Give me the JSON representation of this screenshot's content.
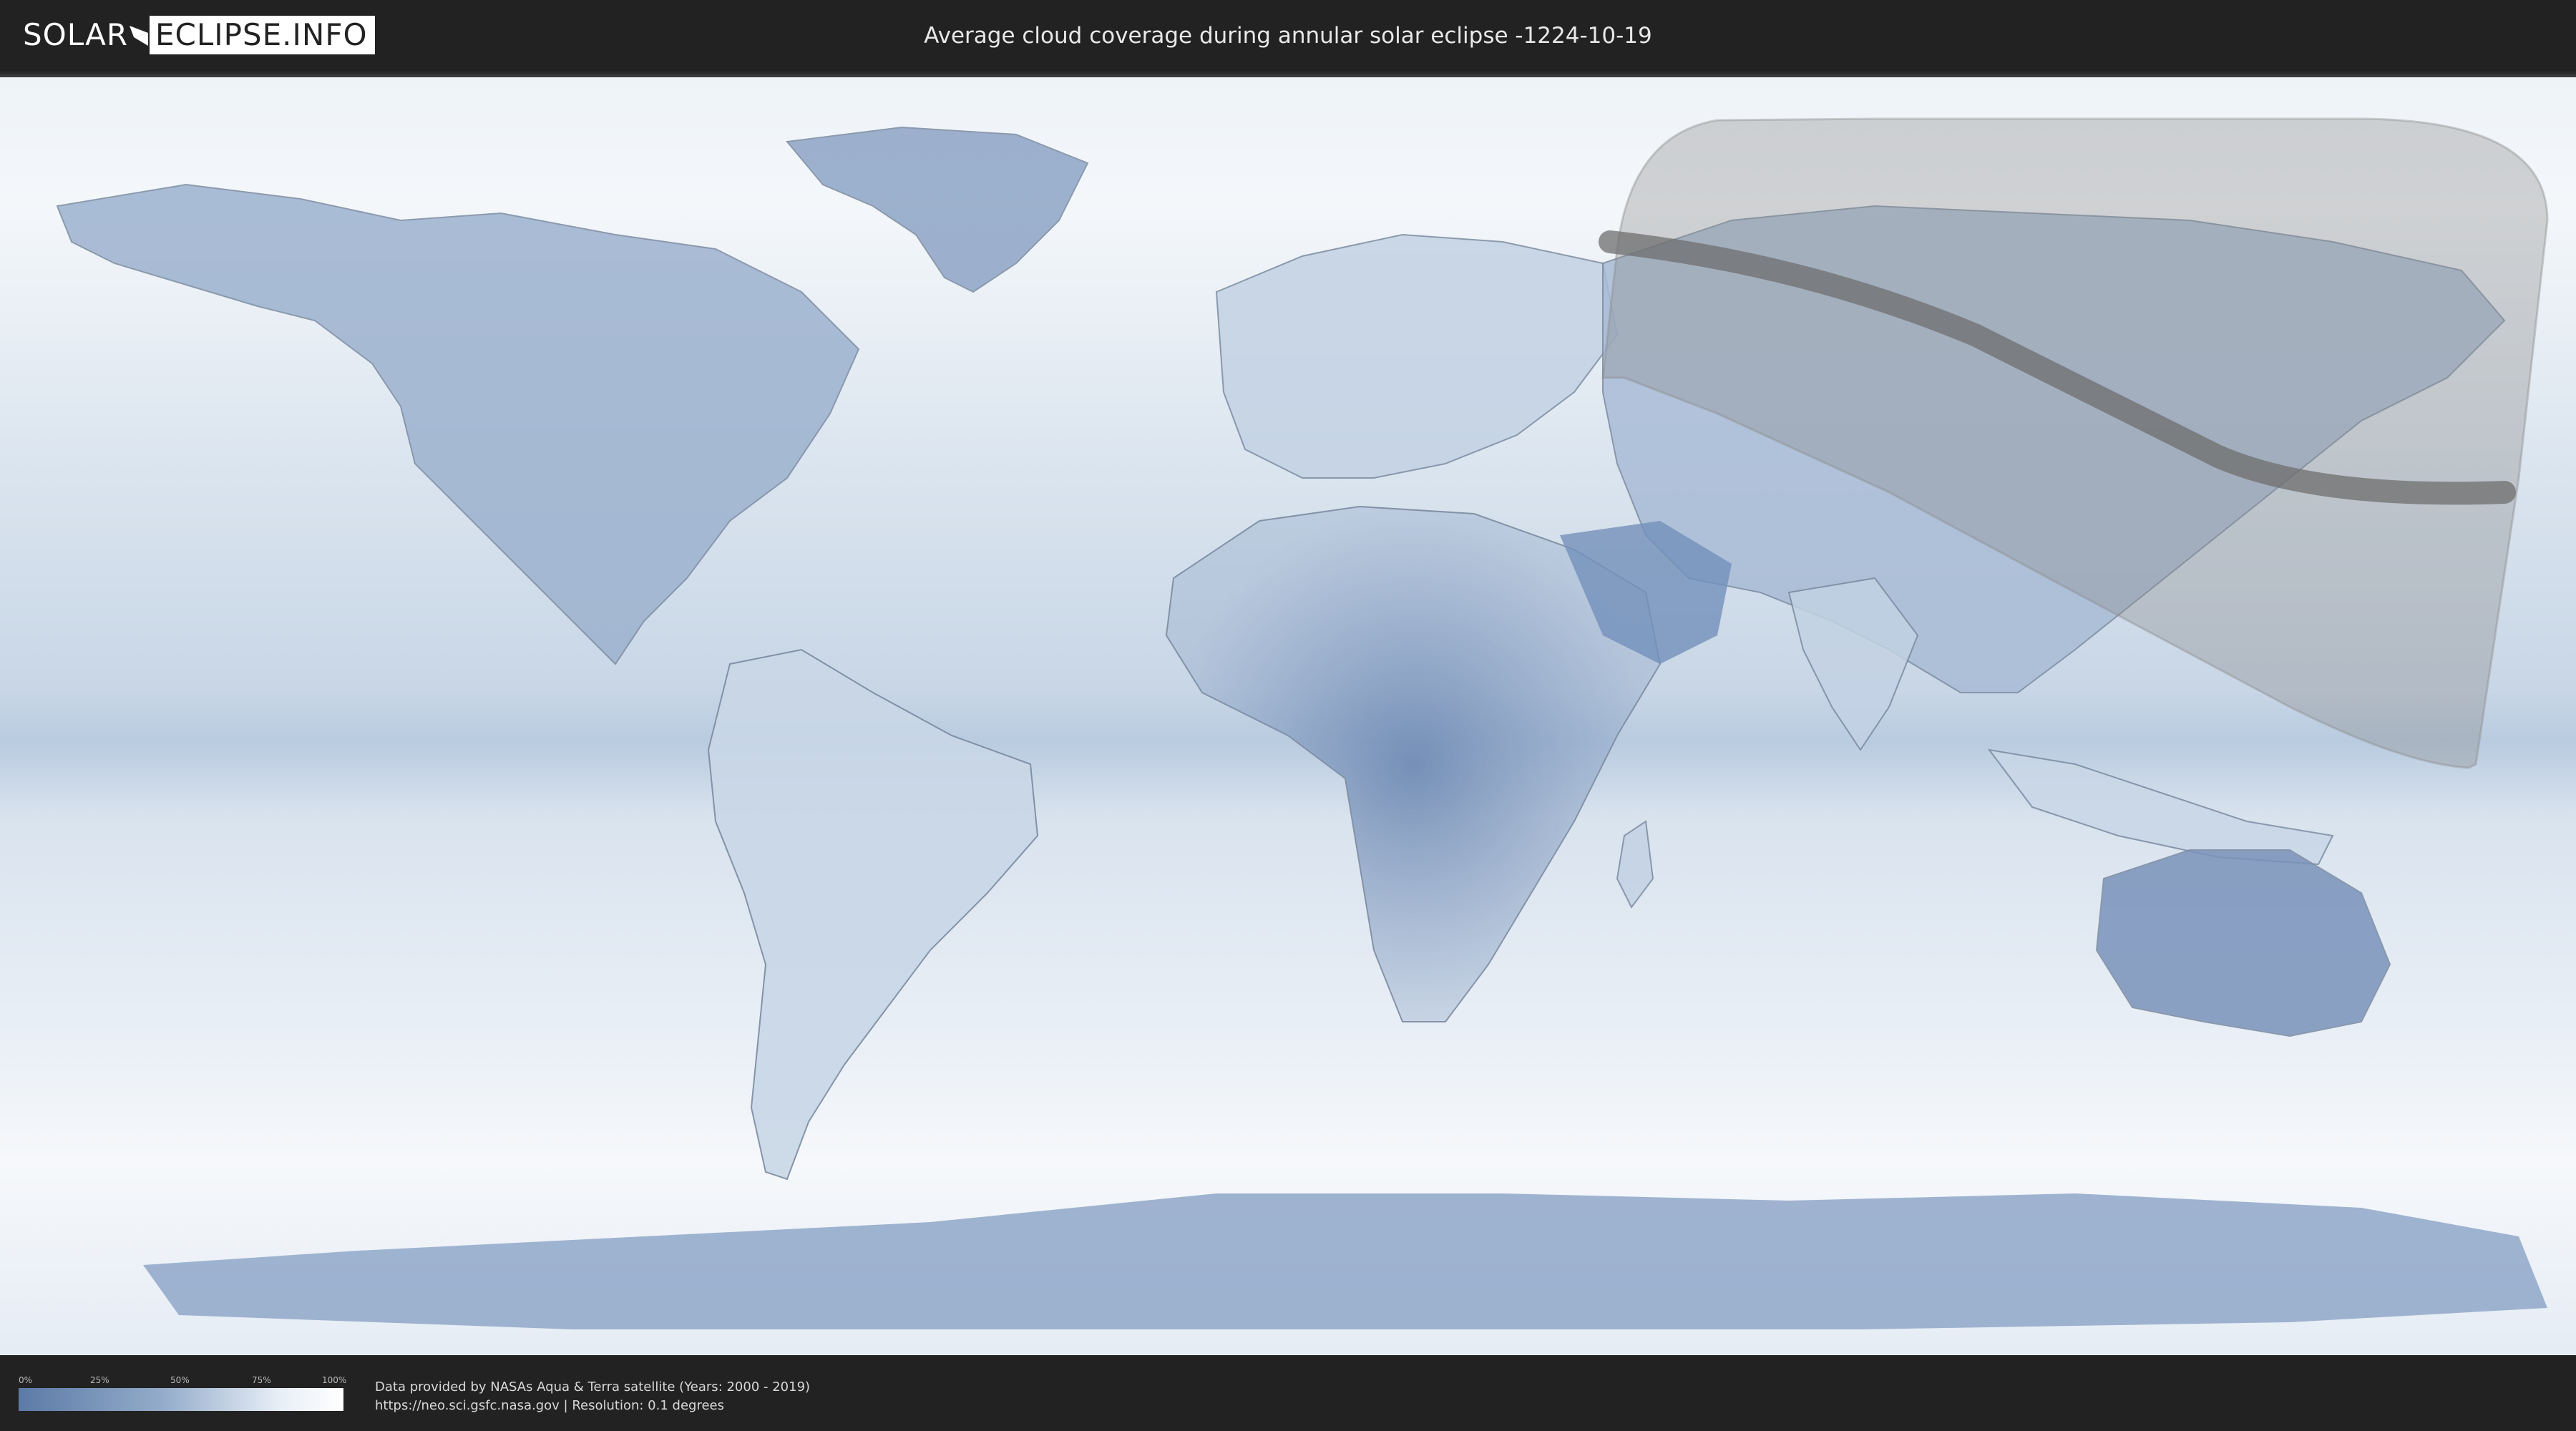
{
  "header": {
    "logo_left": "SOLAR",
    "logo_right": "ECLIPSE.INFO",
    "title": "Average cloud coverage during annular solar eclipse -1224-10-19"
  },
  "legend": {
    "ticks": [
      "0%",
      "25%",
      "50%",
      "75%",
      "100%"
    ],
    "color_low": "#5b7aa6",
    "color_high": "#ffffff"
  },
  "footer": {
    "credit_line1": "Data provided by NASAs Aqua & Terra satellite (Years: 2000 - 2019)",
    "credit_line2": "https://neo.sci.gsfc.nasa.gov | Resolution: 0.1 degrees"
  },
  "colors": {
    "clear_sky": "#5b7aa6",
    "cloudy": "#ffffff",
    "eclipse_zone": "#8a8a8a",
    "central_path": "#6e6e6e"
  },
  "icons": [
    "logo-moon-mark-icon"
  ]
}
